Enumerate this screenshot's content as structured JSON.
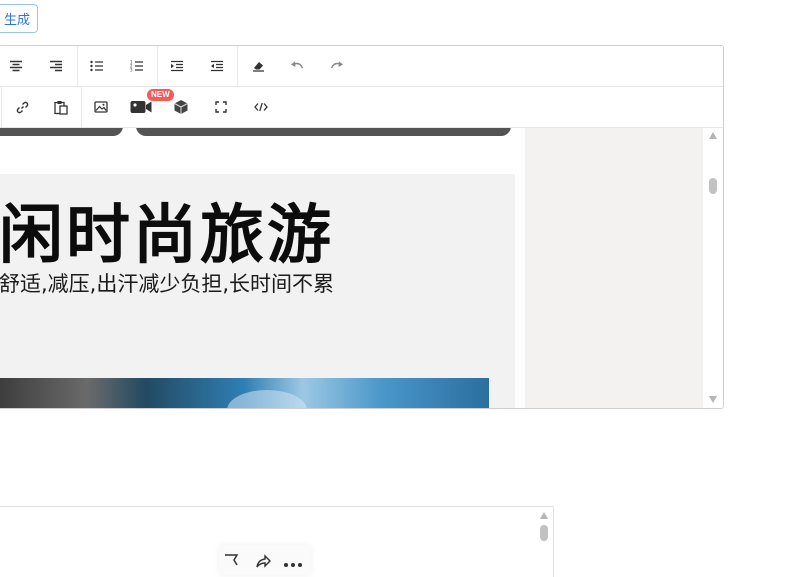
{
  "generate_button": {
    "label": "生成"
  },
  "editor": {
    "toolbar_row1": [
      "align-center",
      "align-right",
      "bulleted-list",
      "numbered-list",
      "indent",
      "outdent",
      "clear-format",
      "undo",
      "redo"
    ],
    "toolbar_row2": [
      "link",
      "paste",
      "image",
      "video",
      "3d-model",
      "fullscreen",
      "source-code"
    ],
    "new_badge": "NEW",
    "content": {
      "headline": "闲时尚旅游",
      "subline": "舒适,减压,出汗减少负担,长时间不累"
    }
  },
  "colors": {
    "accent": "#2f74d8",
    "badge": "#f05b5b",
    "card_bg": "#f2f2f2",
    "gutter_bg": "#f3f2f1"
  }
}
